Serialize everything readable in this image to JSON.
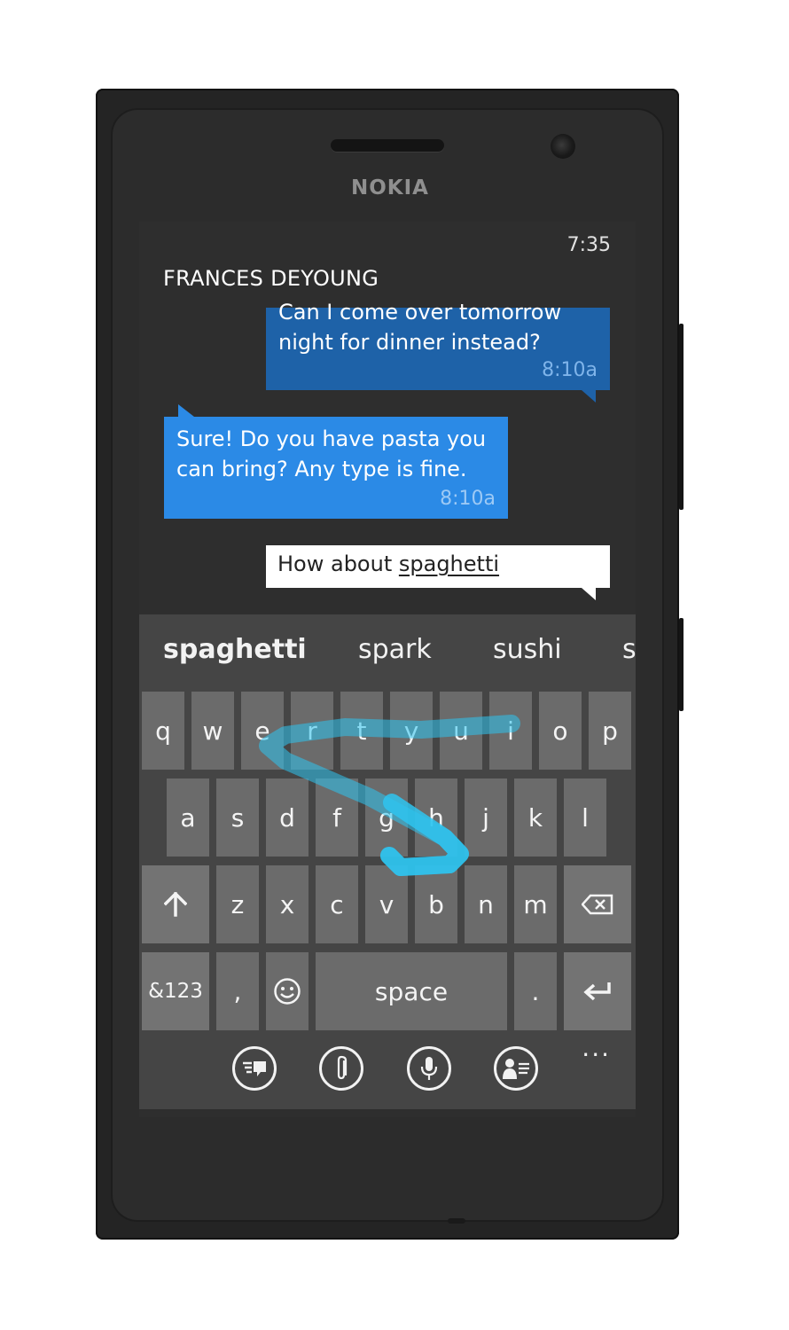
{
  "device": {
    "brand": "NOKIA"
  },
  "status": {
    "time": "7:35"
  },
  "conversation": {
    "contact": "FRANCES DEYOUNG",
    "messages": [
      {
        "text": "Can I come over tomorrow\nnight for dinner instead?",
        "time": "8:10a",
        "direction": "outgoing"
      },
      {
        "text": "Sure! Do you have pasta you\ncan bring? Any type is fine.",
        "time": "8:10a",
        "direction": "incoming"
      }
    ],
    "compose": {
      "prefix": "How about ",
      "current_word": "spaghetti"
    }
  },
  "keyboard": {
    "suggestions": [
      "spaghetti",
      "spark",
      "sushi",
      "s"
    ],
    "row1": [
      "q",
      "w",
      "e",
      "r",
      "t",
      "y",
      "u",
      "i",
      "o",
      "p"
    ],
    "row2": [
      "a",
      "s",
      "d",
      "f",
      "g",
      "h",
      "j",
      "k",
      "l"
    ],
    "row3": [
      "z",
      "x",
      "c",
      "v",
      "b",
      "n",
      "m"
    ],
    "row4": {
      "symbols": "&123",
      "comma": ",",
      "space": "space",
      "period": "."
    },
    "icons": {
      "shift": "shift-arrow-icon",
      "backspace": "backspace-icon",
      "emoji": "smiley-icon",
      "enter": "enter-arrow-icon"
    },
    "trace_color": "#2ec4f0"
  },
  "appbar": {
    "buttons": [
      "switch-sim-icon",
      "attach-icon",
      "voice-icon",
      "contact-info-icon"
    ],
    "more": "..."
  },
  "colors": {
    "outgoing_bubble": "#1e62a8",
    "incoming_bubble": "#2b8ae6",
    "keyboard_bg": "#454545",
    "key_bg": "#6b6b6b"
  }
}
